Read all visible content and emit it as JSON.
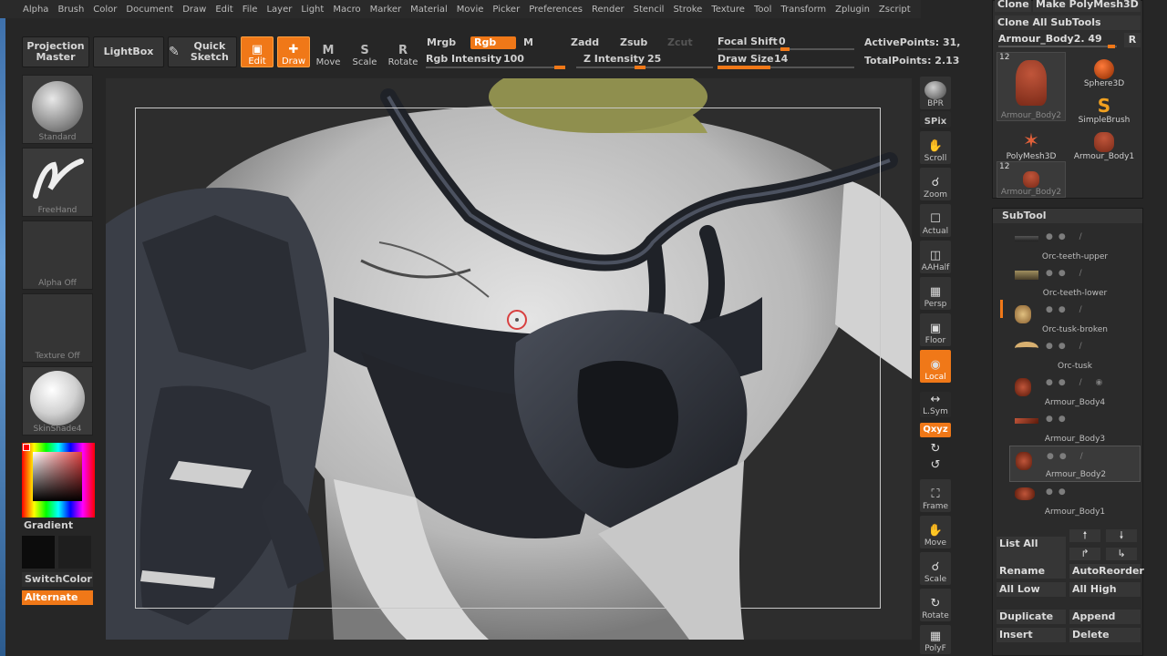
{
  "menu": [
    "Alpha",
    "Brush",
    "Color",
    "Document",
    "Draw",
    "Edit",
    "File",
    "Layer",
    "Light",
    "Macro",
    "Marker",
    "Material",
    "Movie",
    "Picker",
    "Preferences",
    "Render",
    "Stencil",
    "Stroke",
    "Texture",
    "Tool",
    "Transform",
    "Zplugin",
    "Zscript"
  ],
  "shelf": {
    "projection_master": "Projection Master",
    "lightbox": "LightBox",
    "quick_sketch": "Quick Sketch",
    "edit": "Edit",
    "draw": "Draw",
    "move": "Move",
    "scale": "Scale",
    "rotate": "Rotate",
    "move_key": "M",
    "scale_key": "S",
    "rotate_key": "R",
    "mrgb": "Mrgb",
    "rgb": "Rgb",
    "m": "M",
    "rgb_intensity_label": "Rgb Intensity",
    "rgb_intensity": "100",
    "zadd": "Zadd",
    "zsub": "Zsub",
    "zcut": "Zcut",
    "z_intensity_label": "Z Intensity",
    "z_intensity": "25",
    "focal_shift_label": "Focal Shift",
    "focal_shift": "0",
    "draw_size_label": "Draw Size",
    "draw_size": "14",
    "active_points": "ActivePoints: 31,",
    "total_points": "TotalPoints: 2.13"
  },
  "left": {
    "brush_caption": "Standard",
    "stroke_caption": "FreeHand",
    "alpha_caption": "Alpha Off",
    "texture_caption": "Texture Off",
    "material_caption": "SkinShade4",
    "gradient": "Gradient",
    "switch_color": "SwitchColor",
    "alternate": "Alternate"
  },
  "rail": {
    "bpr": "BPR",
    "spix": "SPix",
    "scroll": "Scroll",
    "zoom": "Zoom",
    "actual": "Actual",
    "aahalf": "AAHalf",
    "persp": "Persp",
    "floor": "Floor",
    "local": "Local",
    "lsym": "L.Sym",
    "xyz": "Qxyz",
    "frame": "Frame",
    "move": "Move",
    "scale": "Scale",
    "rotate": "Rotate",
    "polyf": "PolyF"
  },
  "tool": {
    "clone": "Clone",
    "make_polymesh": "Make PolyMesh3D",
    "clone_all": "Clone All SubTools",
    "current_tool": "Armour_Body2. 49",
    "r": "R",
    "thumbs": [
      {
        "name": "Armour_Body2",
        "num": "12"
      },
      {
        "name": "Sphere3D"
      },
      {
        "name": "SimpleBrush"
      },
      {
        "name": "PolyMesh3D"
      },
      {
        "name": "Armour_Body1"
      },
      {
        "name": "Armour_Body2",
        "num": "12"
      }
    ]
  },
  "subtool": {
    "header": "SubTool",
    "items": [
      "Orc-teeth-upper",
      "Orc-teeth-lower",
      "Orc-tusk-broken",
      "Orc-tusk",
      "Armour_Body4",
      "Armour_Body3",
      "Armour_Body2",
      "Armour_Body1"
    ],
    "list_all": "List All",
    "rename": "Rename",
    "auto_reorder": "AutoReorder",
    "all_low": "All Low",
    "all_high": "All High",
    "duplicate": "Duplicate",
    "append": "Append",
    "insert": "Insert",
    "delete": "Delete"
  },
  "colors": {
    "accent": "#f07818",
    "panel": "#2e2e2e",
    "background": "#262626"
  }
}
